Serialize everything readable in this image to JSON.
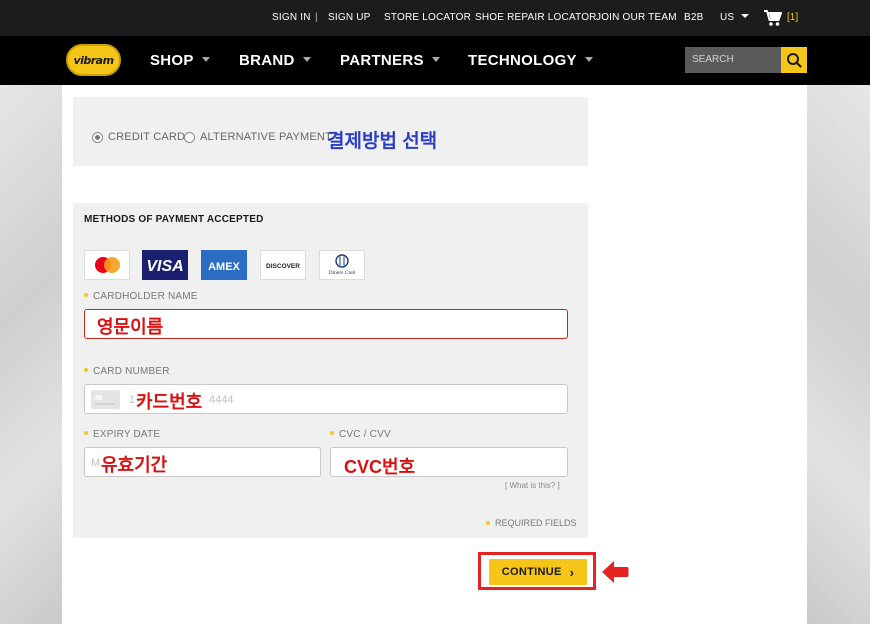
{
  "topbar": {
    "sign_in": "SIGN IN",
    "divider": "|",
    "sign_up": "SIGN UP",
    "store_locator": "STORE LOCATOR",
    "shoe_repair": "SHOE REPAIR LOCATOR",
    "join_team": "JOIN OUR TEAM",
    "b2b": "B2B",
    "region": "US",
    "cart_count": "[1]"
  },
  "nav": {
    "logo_text": "vibram",
    "items": [
      "SHOP",
      "BRAND",
      "PARTNERS",
      "TECHNOLOGY"
    ],
    "search_placeholder": "SEARCH"
  },
  "payment_options": {
    "credit_card": "CREDIT CARD",
    "alternative": "ALTERNATIVE PAYMENT",
    "annotation": "결제방법 선택"
  },
  "methods": {
    "title": "METHODS OF PAYMENT ACCEPTED",
    "cards": [
      "mastercard",
      "VISA",
      "AMEX",
      "DISCOVER",
      "Diners Club"
    ]
  },
  "form": {
    "cardholder_label": "CARDHOLDER NAME",
    "cardholder_annotation": "영문이름",
    "card_number_label": "CARD NUMBER",
    "card_number_placeholder_start": "1",
    "card_number_placeholder_end": "4444",
    "card_number_annotation": "카드번호",
    "expiry_label": "EXPIRY DATE",
    "expiry_placeholder": "M",
    "expiry_annotation": "유효기간",
    "cvc_label": "CVC / CVV",
    "cvc_annotation": "CVC번호",
    "what_is_this": "[ What is this? ]",
    "required": "REQUIRED FIELDS"
  },
  "continue": {
    "label": "CONTINUE",
    "chevron": "›"
  },
  "colors": {
    "accent_yellow": "#f5c518",
    "annotation_red": "#d81010",
    "annotation_blue": "#2a3ec8"
  }
}
